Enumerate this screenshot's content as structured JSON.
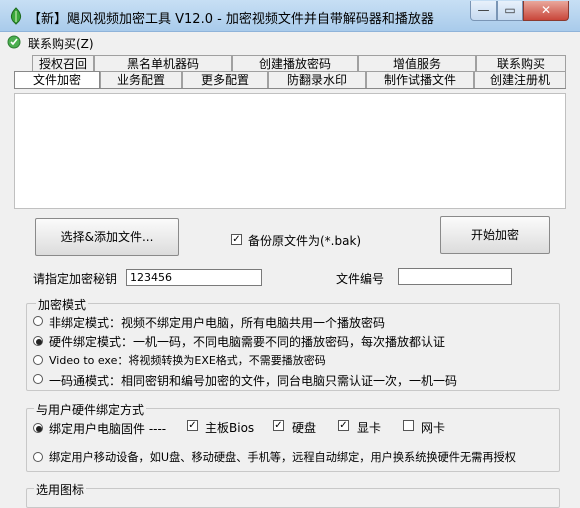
{
  "window": {
    "title": "【新】飓风视频加密工具 V12.0 - 加密视频文件并自带解码器和播放器",
    "min_glyph": "—",
    "max_glyph": "▭",
    "close_glyph": "✕"
  },
  "menu": {
    "contact": "联系购买(Z)"
  },
  "tabs_row1": [
    "授权召回",
    "黑名单机器码",
    "创建播放密码",
    "增值服务",
    "联系购买"
  ],
  "tabs_row2": [
    "文件加密",
    "业务配置",
    "更多配置",
    "防翻录水印",
    "制作试播文件",
    "创建注册机"
  ],
  "active_tab": "文件加密",
  "buttons": {
    "select_files": "选择&添加文件...",
    "start_encrypt": "开始加密"
  },
  "backup": {
    "label": "备份原文件为(*.bak)",
    "checked": true
  },
  "key": {
    "label": "请指定加密秘钥",
    "value": "123456"
  },
  "file_no": {
    "label": "文件编号",
    "value": ""
  },
  "encrypt_mode": {
    "title": "加密模式",
    "options": [
      {
        "label": "非绑定模式：视频不绑定用户电脑，所有电脑共用一个播放密码",
        "selected": false
      },
      {
        "label": "硬件绑定模式：一机一码，不同电脑需要不同的播放密码，每次播放都认证",
        "selected": true
      },
      {
        "label": "Video to exe：将视频转换为EXE格式，不需要播放密码",
        "selected": false
      },
      {
        "label": "一码通模式：相同密钥和编号加密的文件，同台电脑只需认证一次，一机一码",
        "selected": false
      }
    ]
  },
  "hw_bind": {
    "title": "与用户硬件绑定方式",
    "pc_option": {
      "label": "绑定用户电脑固件 ----",
      "selected": true
    },
    "hw_items": [
      {
        "label": "主板Bios",
        "checked": true
      },
      {
        "label": "硬盘",
        "checked": true
      },
      {
        "label": "显卡",
        "checked": true
      },
      {
        "label": "网卡",
        "checked": false
      }
    ],
    "mobile_option": {
      "label": "绑定用户移动设备，如U盘、移动硬盘、手机等，远程自动绑定，用户换系统换硬件无需再授权",
      "selected": false
    }
  },
  "icon_group": {
    "title": "选用图标"
  }
}
